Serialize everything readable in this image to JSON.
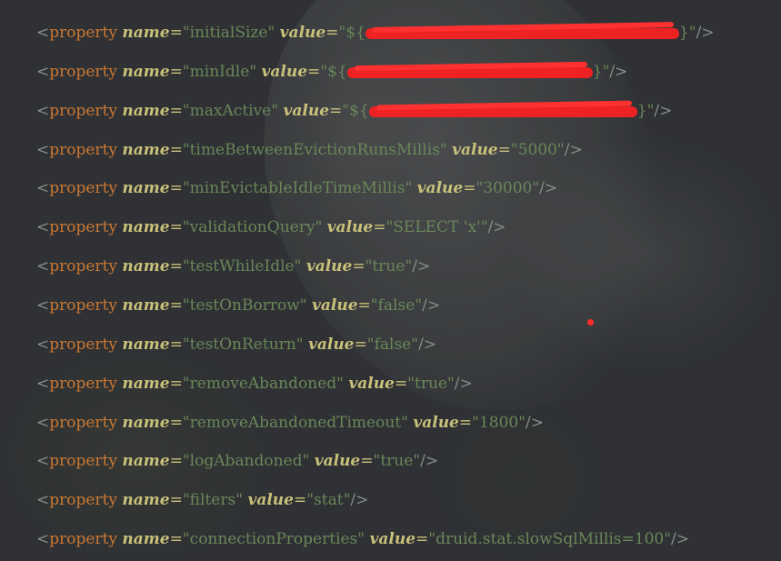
{
  "editor": {
    "lines": [
      {
        "tag": "property",
        "name_attr": "name",
        "name": "initialSize",
        "value_attr": "value",
        "value_prefix": "${",
        "value_suffix": "}",
        "redacted": true
      },
      {
        "tag": "property",
        "name_attr": "name",
        "name": "minIdle",
        "value_attr": "value",
        "value_prefix": "${",
        "value_suffix": "}",
        "redacted": true
      },
      {
        "tag": "property",
        "name_attr": "name",
        "name": "maxActive",
        "value_attr": "value",
        "value_prefix": "${",
        "value_suffix": "}",
        "redacted": true
      },
      {
        "tag": "property",
        "name_attr": "name",
        "name": "timeBetweenEvictionRunsMillis",
        "value_attr": "value",
        "value": "5000"
      },
      {
        "tag": "property",
        "name_attr": "name",
        "name": "minEvictableIdleTimeMillis",
        "value_attr": "value",
        "value": "30000"
      },
      {
        "tag": "property",
        "name_attr": "name",
        "name": "validationQuery",
        "value_attr": "value",
        "value": "SELECT 'x'"
      },
      {
        "tag": "property",
        "name_attr": "name",
        "name": "testWhileIdle",
        "value_attr": "value",
        "value": "true"
      },
      {
        "tag": "property",
        "name_attr": "name",
        "name": "testOnBorrow",
        "value_attr": "value",
        "value": "false"
      },
      {
        "tag": "property",
        "name_attr": "name",
        "name": "testOnReturn",
        "value_attr": "value",
        "value": "false"
      },
      {
        "tag": "property",
        "name_attr": "name",
        "name": "removeAbandoned",
        "value_attr": "value",
        "value": "true"
      },
      {
        "tag": "property",
        "name_attr": "name",
        "name": "removeAbandonedTimeout",
        "value_attr": "value",
        "value": "1800"
      },
      {
        "tag": "property",
        "name_attr": "name",
        "name": "logAbandoned",
        "value_attr": "value",
        "value": "true"
      },
      {
        "tag": "property",
        "name_attr": "name",
        "name": "filters",
        "value_attr": "value",
        "value": "stat"
      },
      {
        "tag": "property",
        "name_attr": "name",
        "name": "connectionProperties",
        "value_attr": "value",
        "value": "druid.stat.slowSqlMillis=100"
      }
    ]
  },
  "colors": {
    "tag": "#cc7832",
    "attribute": "#c9c17a",
    "value": "#6a8759",
    "redaction": "#ee2222"
  }
}
